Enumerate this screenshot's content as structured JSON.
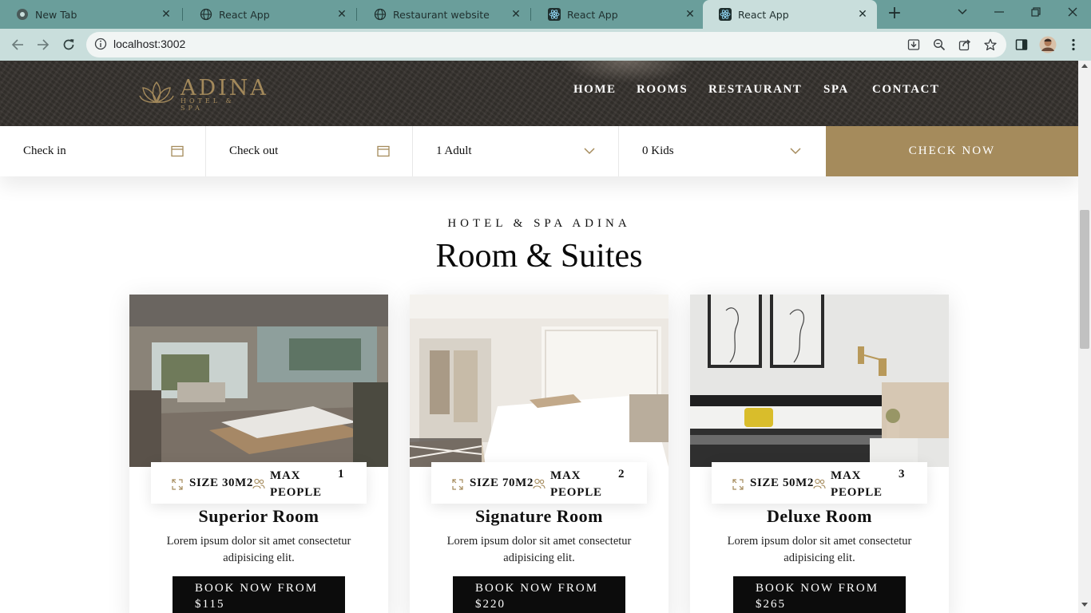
{
  "browser": {
    "tabs": [
      {
        "title": "New Tab",
        "favicon": "chrome-icon"
      },
      {
        "title": "React App",
        "favicon": "globe-icon"
      },
      {
        "title": "Restaurant website",
        "favicon": "globe-icon"
      },
      {
        "title": "React App",
        "favicon": "react-icon"
      },
      {
        "title": "React App",
        "favicon": "react-icon",
        "active": true
      }
    ],
    "url": "localhost:3002",
    "colors": {
      "tabstrip": "#6a9e9b",
      "toolbar": "#c9dedc"
    }
  },
  "site": {
    "logo": {
      "name": "ADINA",
      "sub": "HOTEL & SPA"
    },
    "nav": [
      "HOME",
      "ROOMS",
      "RESTAURANT",
      "SPA",
      "CONTACT"
    ],
    "colors": {
      "accent": "#a58b5c",
      "dark": "#0c0c0c"
    }
  },
  "booking": {
    "checkin": "Check in",
    "checkout": "Check out",
    "adults": "1 Adult",
    "kids": "0 Kids",
    "submit": "CHECK NOW"
  },
  "section": {
    "eyebrow": "HOTEL & SPA ADINA",
    "title": "Room & Suites"
  },
  "rooms": [
    {
      "size": "SIZE 30M2",
      "max_label": "MAX PEOPLE",
      "max": "1",
      "name": "Superior Room",
      "desc": "Lorem ipsum dolor sit amet consectetur adipisicing elit.",
      "book_line1": "BOOK NOW FROM",
      "book_line2": "$115"
    },
    {
      "size": "SIZE 70M2",
      "max_label": "MAX PEOPLE",
      "max": "2",
      "name": "Signature Room",
      "desc": "Lorem ipsum dolor sit amet consectetur adipisicing elit.",
      "book_line1": "BOOK NOW FROM",
      "book_line2": "$220"
    },
    {
      "size": "SIZE 50M2",
      "max_label": "MAX PEOPLE",
      "max": "3",
      "name": "Deluxe Room",
      "desc": "Lorem ipsum dolor sit amet consectetur adipisicing elit.",
      "book_line1": "BOOK NOW FROM",
      "book_line2": "$265"
    }
  ]
}
